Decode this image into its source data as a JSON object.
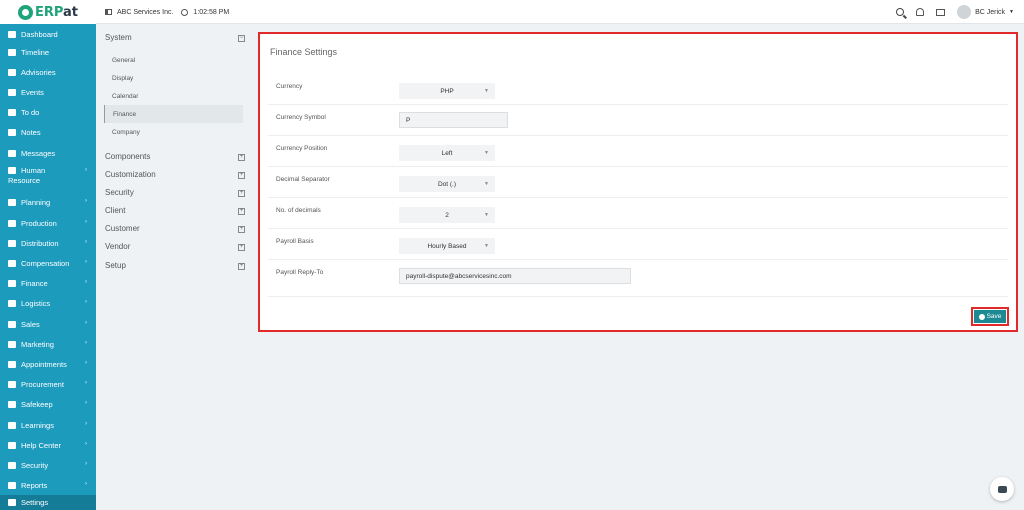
{
  "header": {
    "brand_prefix": "ERP",
    "brand_suffix": "at",
    "company": "ABC Services Inc.",
    "time": "1:02:58 PM",
    "user": "BC Jerick"
  },
  "sidebar": {
    "items": [
      {
        "label": "Dashboard",
        "icon": "dashboard-icon",
        "has_chevron": false
      },
      {
        "label": "Timeline",
        "icon": "timeline-icon",
        "has_chevron": false
      },
      {
        "label": "Advisories",
        "icon": "megaphone-icon",
        "has_chevron": false
      },
      {
        "label": "Events",
        "icon": "calendar-icon",
        "has_chevron": false
      },
      {
        "label": "To do",
        "icon": "checkbox-icon",
        "has_chevron": false
      },
      {
        "label": "Notes",
        "icon": "note-icon",
        "has_chevron": false
      },
      {
        "label": "Messages",
        "icon": "envelope-icon",
        "has_chevron": false
      },
      {
        "label": "Human Resource",
        "icon": "users-icon",
        "has_chevron": true
      },
      {
        "label": "Planning",
        "icon": "planning-icon",
        "has_chevron": true
      },
      {
        "label": "Production",
        "icon": "flask-icon",
        "has_chevron": true
      },
      {
        "label": "Distribution",
        "icon": "bank-icon",
        "has_chevron": true
      },
      {
        "label": "Compensation",
        "icon": "handshake-icon",
        "has_chevron": true
      },
      {
        "label": "Finance",
        "icon": "money-icon",
        "has_chevron": true
      },
      {
        "label": "Logistics",
        "icon": "boxes-icon",
        "has_chevron": true
      },
      {
        "label": "Sales",
        "icon": "cart-icon",
        "has_chevron": true
      },
      {
        "label": "Marketing",
        "icon": "line-chart-icon",
        "has_chevron": true
      },
      {
        "label": "Appointments",
        "icon": "edit-icon",
        "has_chevron": true
      },
      {
        "label": "Procurement",
        "icon": "cubes-icon",
        "has_chevron": true
      },
      {
        "label": "Safekeep",
        "icon": "safe-icon",
        "has_chevron": true
      },
      {
        "label": "Learnings",
        "icon": "graduation-cap-icon",
        "has_chevron": true
      },
      {
        "label": "Help Center",
        "icon": "lifebuoy-icon",
        "has_chevron": true
      },
      {
        "label": "Security",
        "icon": "shield-icon",
        "has_chevron": true
      },
      {
        "label": "Reports",
        "icon": "pie-chart-icon",
        "has_chevron": true
      },
      {
        "label": "Settings",
        "icon": "wrench-icon",
        "has_chevron": false
      }
    ]
  },
  "settings_nav": {
    "system": {
      "label": "System",
      "toggle": "−",
      "subitems": [
        "General",
        "Display",
        "Calendar",
        "Finance",
        "Company"
      ]
    },
    "groups": [
      {
        "label": "Components",
        "toggle": "+"
      },
      {
        "label": "Customization",
        "toggle": "+"
      },
      {
        "label": "Security",
        "toggle": "+"
      },
      {
        "label": "Client",
        "toggle": "+"
      },
      {
        "label": "Customer",
        "toggle": "+"
      },
      {
        "label": "Vendor",
        "toggle": "+"
      },
      {
        "label": "Setup",
        "toggle": "+"
      }
    ]
  },
  "finance": {
    "title": "Finance Settings",
    "fields": [
      {
        "label": "Currency",
        "type": "select",
        "value": "PHP"
      },
      {
        "label": "Currency Symbol",
        "type": "input",
        "value": "P"
      },
      {
        "label": "Currency Position",
        "type": "select",
        "value": "Left"
      },
      {
        "label": "Decimal Separator",
        "type": "select",
        "value": "Dot (.)"
      },
      {
        "label": "No. of decimals",
        "type": "select",
        "value": "2"
      },
      {
        "label": "Payroll Basis",
        "type": "select",
        "value": "Hourly Based"
      },
      {
        "label": "Payroll Reply-To",
        "type": "input",
        "value": "payroll-dispute@abcservicesinc.com"
      }
    ],
    "save_label": "Save"
  },
  "colors": {
    "sidebar": "#1d9bbd",
    "highlight_border": "#e12a2a",
    "save_button": "#1d8a93"
  }
}
